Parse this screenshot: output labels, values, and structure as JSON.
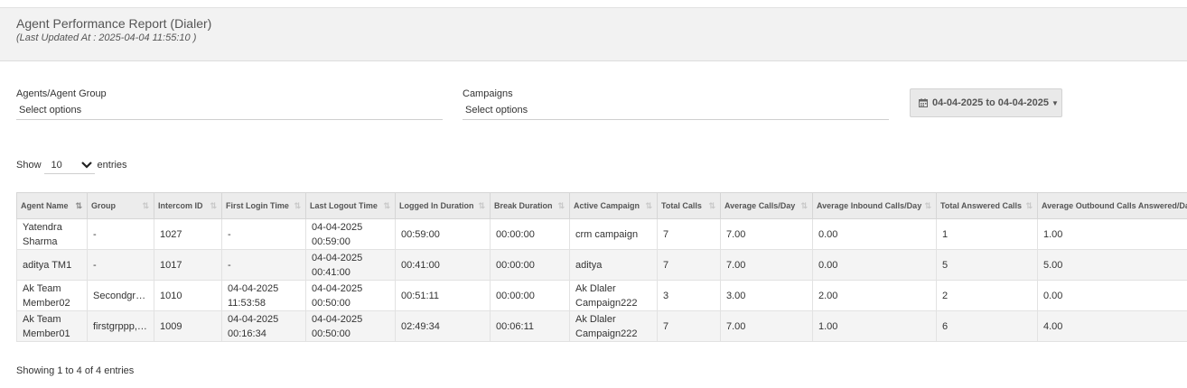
{
  "header": {
    "title": "Agent Performance Report (Dialer)",
    "last_updated": "(Last Updated At : 2025-04-04 11:55:10 )"
  },
  "filters": {
    "agents_label": "Agents/Agent Group",
    "agents_value": "Select options",
    "campaigns_label": "Campaigns",
    "campaigns_value": "Select options",
    "date_range": "04-04-2025 to 04-04-2025"
  },
  "entries": {
    "show_label": "Show",
    "value": "10",
    "suffix": "entries"
  },
  "table": {
    "columns": [
      "Agent Name",
      "Group",
      "Intercom ID",
      "First Login Time",
      "Last Logout Time",
      "Logged In Duration",
      "Break Duration",
      "Active Campaign",
      "Total Calls",
      "Average Calls/Day",
      "Average Inbound Calls/Day",
      "Total Answered Calls",
      "Average Outbound Calls Answered/Day"
    ],
    "rows": [
      [
        "Yatendra Sharma",
        "-",
        "1027",
        "-",
        "04-04-2025 00:59:00",
        "00:59:00",
        "00:00:00",
        "crm campaign",
        "7",
        "7.00",
        "0.00",
        "1",
        "1.00"
      ],
      [
        "aditya TM1",
        "-",
        "1017",
        "-",
        "04-04-2025 00:41:00",
        "00:41:00",
        "00:00:00",
        "aditya",
        "7",
        "7.00",
        "0.00",
        "5",
        "5.00"
      ],
      [
        "Ak Team Member02",
        "Secondgrp…",
        "1010",
        "04-04-2025 11:53:58",
        "04-04-2025 00:50:00",
        "00:51:11",
        "00:00:00",
        "Ak Dlaler Campaign222",
        "3",
        "3.00",
        "2.00",
        "2",
        "0.00"
      ],
      [
        "Ak Team Member01",
        "firstgrppp,t…",
        "1009",
        "04-04-2025 00:16:34",
        "04-04-2025 00:50:00",
        "02:49:34",
        "00:06:11",
        "Ak Dlaler Campaign222",
        "7",
        "7.00",
        "1.00",
        "6",
        "4.00"
      ]
    ]
  },
  "footer": {
    "info": "Showing 1 to 4 of 4 entries"
  }
}
